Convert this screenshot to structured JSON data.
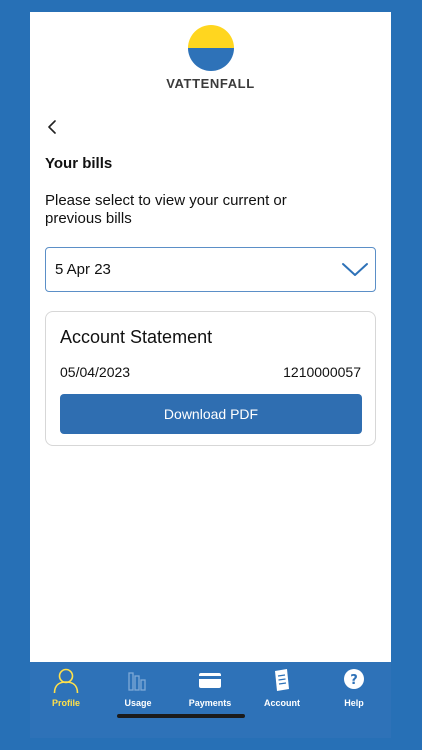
{
  "app": {
    "brand": "VATTENFALL",
    "brand_colors": {
      "yellow": "#ffd61f",
      "blue": "#2e72b8"
    }
  },
  "header": {
    "back_icon": "chevron-left-icon"
  },
  "page": {
    "title": "Your bills",
    "subtitle": "Please select to view your current or previous bills"
  },
  "bill_select": {
    "selected": "5 Apr 23",
    "icon": "chevron-down-icon"
  },
  "statement": {
    "title": "Account Statement",
    "date": "05/04/2023",
    "number": "1210000057",
    "download_label": "Download PDF"
  },
  "nav": {
    "items": [
      {
        "label": "Profile",
        "icon": "profile-icon",
        "active": true
      },
      {
        "label": "Usage",
        "icon": "usage-icon",
        "active": false
      },
      {
        "label": "Payments",
        "icon": "payments-icon",
        "active": false
      },
      {
        "label": "Account",
        "icon": "account-icon",
        "active": false
      },
      {
        "label": "Help",
        "icon": "help-icon",
        "active": false
      }
    ]
  }
}
